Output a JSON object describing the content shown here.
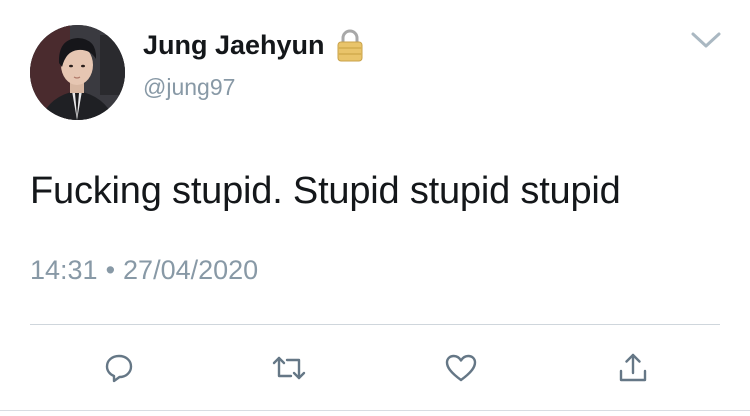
{
  "user": {
    "display_name": "Jung Jaehyun",
    "handle": "@jung97",
    "protected_icon": "lock-icon"
  },
  "tweet": {
    "text": "Fucking stupid. Stupid stupid stupid",
    "time": "14:31",
    "separator": "•",
    "date": "27/04/2020"
  },
  "actions": {
    "reply_icon": "reply-icon",
    "retweet_icon": "retweet-icon",
    "like_icon": "heart-icon",
    "share_icon": "share-icon"
  },
  "colors": {
    "text_primary": "#14171a",
    "text_secondary": "#8899a6",
    "icon": "#657786",
    "divider": "#cfd6dc"
  }
}
